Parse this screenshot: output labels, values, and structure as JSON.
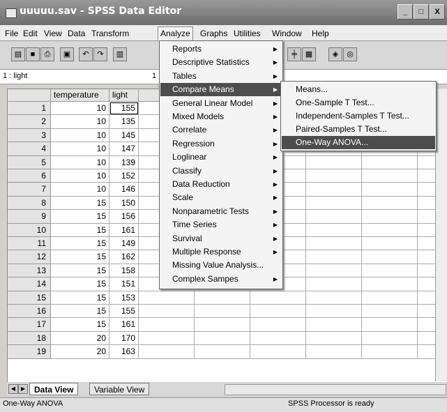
{
  "window": {
    "title": "uuuuu.sav - SPSS Data Editor",
    "controls": [
      "_",
      "□",
      "X"
    ]
  },
  "menubar": [
    "File",
    "Edit",
    "View",
    "Data",
    "Transform",
    "Analyze",
    "Graphs",
    "Utilities",
    "Window",
    "Help"
  ],
  "toolbar": {
    "icons": [
      "open-icon",
      "save-icon",
      "print-icon",
      "dialog-recall-icon",
      "undo-icon",
      "redo-icon",
      "goto-chart-icon",
      "split-file-icon",
      "select-cases-icon",
      "value-labels-icon",
      "use-sets-icon"
    ]
  },
  "cell_editor": {
    "name": "1 : light",
    "value": "1"
  },
  "grid": {
    "headers": [
      "temperature",
      "light"
    ],
    "rows": [
      {
        "num": "1",
        "temperature": "10",
        "light": "155"
      },
      {
        "num": "2",
        "temperature": "10",
        "light": "135"
      },
      {
        "num": "3",
        "temperature": "10",
        "light": "145"
      },
      {
        "num": "4",
        "temperature": "10",
        "light": "147"
      },
      {
        "num": "5",
        "temperature": "10",
        "light": "139"
      },
      {
        "num": "6",
        "temperature": "10",
        "light": "152"
      },
      {
        "num": "7",
        "temperature": "10",
        "light": "146"
      },
      {
        "num": "8",
        "temperature": "15",
        "light": "150"
      },
      {
        "num": "9",
        "temperature": "15",
        "light": "156"
      },
      {
        "num": "10",
        "temperature": "15",
        "light": "161"
      },
      {
        "num": "11",
        "temperature": "15",
        "light": "149"
      },
      {
        "num": "12",
        "temperature": "15",
        "light": "162"
      },
      {
        "num": "13",
        "temperature": "15",
        "light": "158"
      },
      {
        "num": "14",
        "temperature": "15",
        "light": "151"
      },
      {
        "num": "15",
        "temperature": "15",
        "light": "153"
      },
      {
        "num": "16",
        "temperature": "15",
        "light": "155"
      },
      {
        "num": "17",
        "temperature": "15",
        "light": "161"
      },
      {
        "num": "18",
        "temperature": "20",
        "light": "170"
      },
      {
        "num": "19",
        "temperature": "20",
        "light": "163"
      }
    ]
  },
  "analyze_menu": {
    "items": [
      {
        "label": "Reports",
        "submenu": true
      },
      {
        "label": "Descriptive Statistics",
        "submenu": true
      },
      {
        "label": "Tables",
        "submenu": true
      },
      {
        "label": "Compare Means",
        "submenu": true,
        "highlighted": true
      },
      {
        "label": "General Linear Model",
        "submenu": true
      },
      {
        "label": "Mixed Models",
        "submenu": true
      },
      {
        "label": "Correlate",
        "submenu": true
      },
      {
        "label": "Regression",
        "submenu": true
      },
      {
        "label": "Loglinear",
        "submenu": true
      },
      {
        "label": "Classify",
        "submenu": true
      },
      {
        "label": "Data Reduction",
        "submenu": true
      },
      {
        "label": "Scale",
        "submenu": true
      },
      {
        "label": "Nonparametric Tests",
        "submenu": true
      },
      {
        "label": "Time Series",
        "submenu": true
      },
      {
        "label": "Survival",
        "submenu": true
      },
      {
        "label": "Multiple Response",
        "submenu": true
      },
      {
        "label": "Missing Value Analysis...",
        "submenu": false
      },
      {
        "label": "Complex Sampes",
        "submenu": true
      }
    ]
  },
  "compare_means_submenu": {
    "items": [
      {
        "label": "Means..."
      },
      {
        "label": "One-Sample T Test..."
      },
      {
        "label": "Independent-Samples T Test..."
      },
      {
        "label": "Paired-Samples T Test..."
      },
      {
        "label": "One-Way ANOVA...",
        "highlighted": true
      }
    ]
  },
  "tabs": {
    "data_view": "Data View",
    "variable_view": "Variable View"
  },
  "status": {
    "left": "One-Way ANOVA",
    "right": "SPSS Processor  is ready"
  }
}
